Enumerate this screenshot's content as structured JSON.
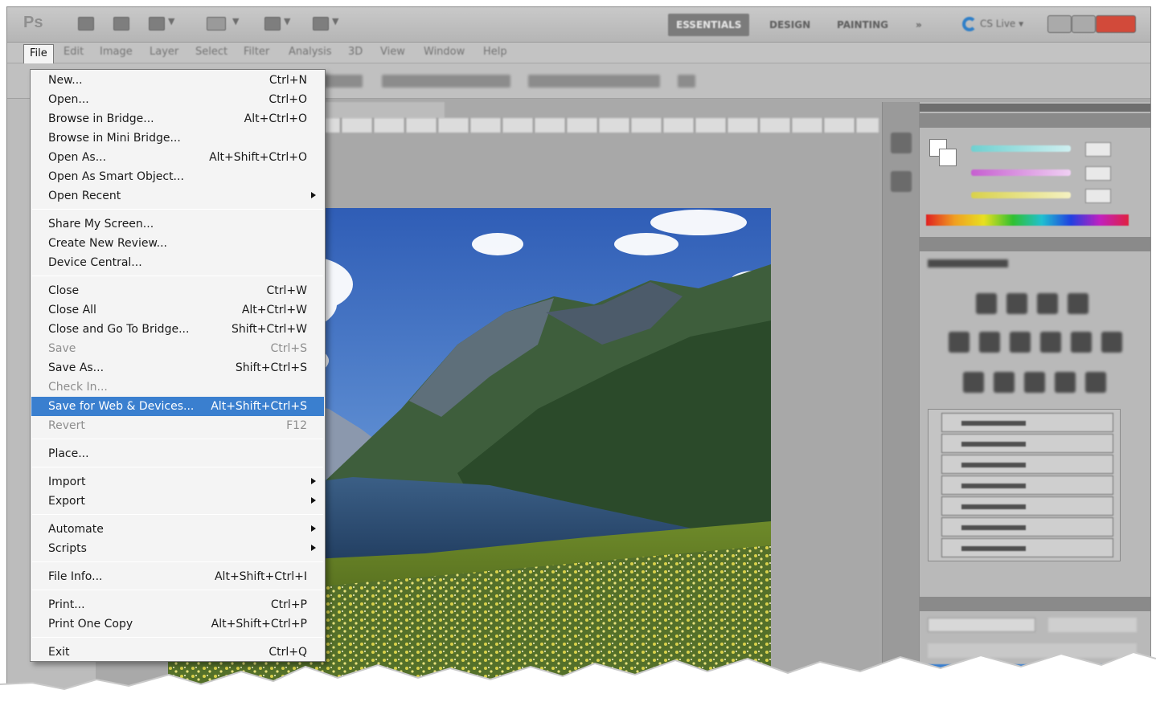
{
  "menubar": {
    "file": "File",
    "items": [
      "Edit",
      "Image",
      "Layer",
      "Select",
      "Filter",
      "Analysis",
      "3D",
      "View",
      "Window",
      "Help"
    ]
  },
  "workspaces": [
    "ESSENTIALS",
    "DESIGN",
    "PAINTING",
    "»"
  ],
  "cslive": "CS Live ▾",
  "file_menu": {
    "groups": [
      [
        {
          "label": "New...",
          "shortcut": "Ctrl+N"
        },
        {
          "label": "Open...",
          "shortcut": "Ctrl+O"
        },
        {
          "label": "Browse in Bridge...",
          "shortcut": "Alt+Ctrl+O"
        },
        {
          "label": "Browse in Mini Bridge...",
          "shortcut": ""
        },
        {
          "label": "Open As...",
          "shortcut": "Alt+Shift+Ctrl+O"
        },
        {
          "label": "Open As Smart Object...",
          "shortcut": ""
        },
        {
          "label": "Open Recent",
          "shortcut": "",
          "submenu": true
        }
      ],
      [
        {
          "label": "Share My Screen...",
          "shortcut": ""
        },
        {
          "label": "Create New Review...",
          "shortcut": ""
        },
        {
          "label": "Device Central...",
          "shortcut": ""
        }
      ],
      [
        {
          "label": "Close",
          "shortcut": "Ctrl+W"
        },
        {
          "label": "Close All",
          "shortcut": "Alt+Ctrl+W"
        },
        {
          "label": "Close and Go To Bridge...",
          "shortcut": "Shift+Ctrl+W"
        },
        {
          "label": "Save",
          "shortcut": "Ctrl+S",
          "disabled": true
        },
        {
          "label": "Save As...",
          "shortcut": "Shift+Ctrl+S"
        },
        {
          "label": "Check In...",
          "shortcut": "",
          "disabled": true
        },
        {
          "label": "Save for Web & Devices...",
          "shortcut": "Alt+Shift+Ctrl+S",
          "highlighted": true
        },
        {
          "label": "Revert",
          "shortcut": "F12",
          "disabled": true
        }
      ],
      [
        {
          "label": "Place...",
          "shortcut": ""
        }
      ],
      [
        {
          "label": "Import",
          "shortcut": "",
          "submenu": true
        },
        {
          "label": "Export",
          "shortcut": "",
          "submenu": true
        }
      ],
      [
        {
          "label": "Automate",
          "shortcut": "",
          "submenu": true
        },
        {
          "label": "Scripts",
          "shortcut": "",
          "submenu": true
        }
      ],
      [
        {
          "label": "File Info...",
          "shortcut": "Alt+Shift+Ctrl+I"
        }
      ],
      [
        {
          "label": "Print...",
          "shortcut": "Ctrl+P"
        },
        {
          "label": "Print One Copy",
          "shortcut": "Alt+Shift+Ctrl+P"
        }
      ],
      [
        {
          "label": "Exit",
          "shortcut": "Ctrl+Q"
        }
      ]
    ]
  },
  "colors": {
    "highlight": "#3a7fcf",
    "menu_bg": "#f4f4f4",
    "app_bg": "#a9a9a9"
  }
}
